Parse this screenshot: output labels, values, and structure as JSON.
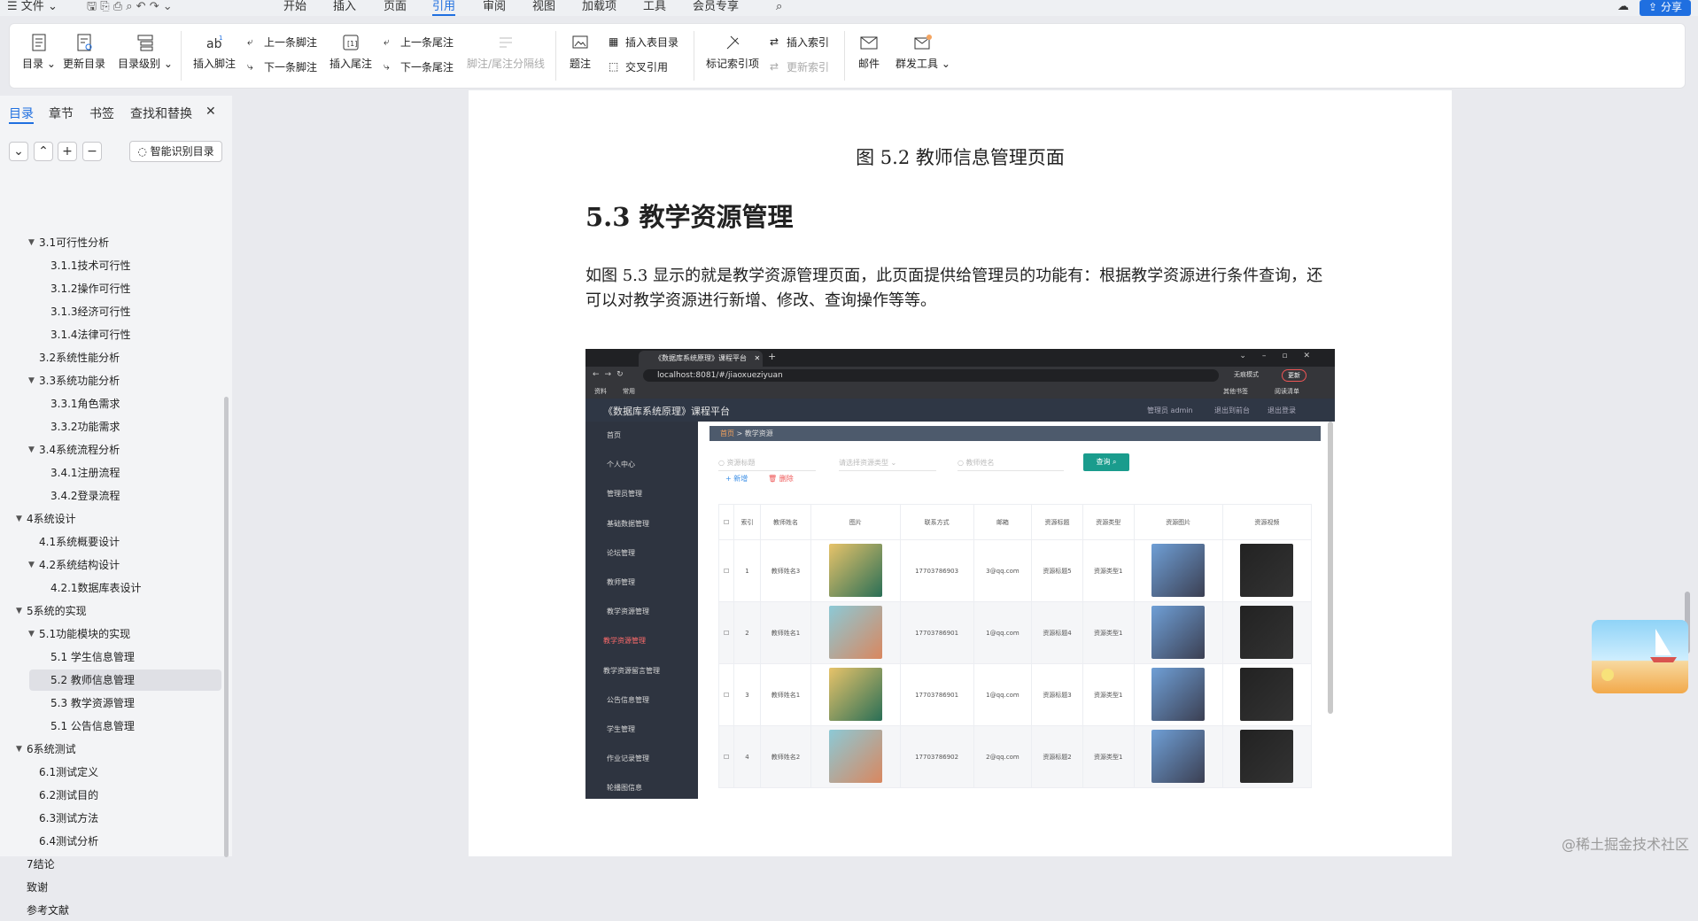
{
  "menubar": {
    "file": "文件",
    "tabs": [
      "开始",
      "插入",
      "页面",
      "引用",
      "审阅",
      "视图",
      "加载项",
      "工具",
      "会员专享"
    ],
    "active_tab": "引用",
    "share": "分享"
  },
  "ribbon": {
    "toc": "目录",
    "update_toc": "更新目录",
    "toc_level": "目录级别",
    "insert_footnote": "插入脚注",
    "prev_footnote": "上一条脚注",
    "next_footnote": "下一条脚注",
    "insert_endnote": "插入尾注",
    "prev_endnote": "上一条尾注",
    "next_endnote": "下一条尾注",
    "separator": "脚注/尾注分隔线",
    "caption": "题注",
    "insert_table_toc": "插入表目录",
    "cross_ref": "交叉引用",
    "mark_index": "标记索引项",
    "insert_index": "插入索引",
    "update_index": "更新索引",
    "mail": "邮件",
    "mass_tools": "群发工具"
  },
  "sidebar": {
    "tabs": [
      "目录",
      "章节",
      "书签",
      "查找和替换"
    ],
    "active_tab": "目录",
    "ai_button": "智能识别目录",
    "items": [
      {
        "text": "3.1可行性分析",
        "level": 2,
        "expanded": true
      },
      {
        "text": "3.1.1技术可行性",
        "level": 3
      },
      {
        "text": "3.1.2操作可行性",
        "level": 3
      },
      {
        "text": "3.1.3经济可行性",
        "level": 3
      },
      {
        "text": "3.1.4法律可行性",
        "level": 3
      },
      {
        "text": "3.2系统性能分析",
        "level": 2
      },
      {
        "text": "3.3系统功能分析",
        "level": 2,
        "expanded": true
      },
      {
        "text": "3.3.1角色需求",
        "level": 3
      },
      {
        "text": "3.3.2功能需求",
        "level": 3
      },
      {
        "text": "3.4系统流程分析",
        "level": 2,
        "expanded": true
      },
      {
        "text": "3.4.1注册流程",
        "level": 3
      },
      {
        "text": "3.4.2登录流程",
        "level": 3
      },
      {
        "text": "4系统设计",
        "level": 1,
        "expanded": true
      },
      {
        "text": "4.1系统概要设计",
        "level": 2
      },
      {
        "text": "4.2系统结构设计",
        "level": 2,
        "expanded": true
      },
      {
        "text": "4.2.1数据库表设计",
        "level": 3
      },
      {
        "text": "5系统的实现",
        "level": 1,
        "expanded": true
      },
      {
        "text": "5.1功能模块的实现",
        "level": 2,
        "expanded": true
      },
      {
        "text": "5.1 学生信息管理",
        "level": 3
      },
      {
        "text": "5.2  教师信息管理",
        "level": 3,
        "selected": true
      },
      {
        "text": "5.3 教学资源管理",
        "level": 3
      },
      {
        "text": "5.1 公告信息管理",
        "level": 3
      },
      {
        "text": "6系统测试",
        "level": 1,
        "expanded": true
      },
      {
        "text": "6.1测试定义",
        "level": 2
      },
      {
        "text": "6.2测试目的",
        "level": 2
      },
      {
        "text": "6.3测试方法",
        "level": 2
      },
      {
        "text": "6.4测试分析",
        "level": 2
      },
      {
        "text": "7结论",
        "level": 1
      },
      {
        "text": "致谢",
        "level": 1
      },
      {
        "text": "参考文献",
        "level": 1
      }
    ]
  },
  "document": {
    "caption": "图 5.2  教师信息管理页面",
    "heading": "5.3 教学资源管理",
    "paragraph": "如图 5.3 显示的就是教学资源管理页面，此页面提供给管理员的功能有：根据教学资源进行条件查询，还可以对教学资源进行新增、修改、查询操作等等。"
  },
  "screenshot": {
    "browser_tab": "《数据库系统原理》课程平台",
    "url": "localhost:8081/#/jiaoxueziyuan",
    "incognito": "无痕模式",
    "update": "更新",
    "bookmarks": [
      "资料",
      "常用"
    ],
    "bookmarks_right": [
      "其他书签",
      "阅读清单"
    ],
    "app_title": "《数据库系统原理》课程平台",
    "admin": "管理员 admin",
    "back_home": "退出到前台",
    "logout": "退出登录",
    "menu": [
      "首页",
      "个人中心",
      "管理员管理",
      "基础数据管理",
      "论坛管理",
      "教师管理",
      "教学资源管理",
      "教学资源管理",
      "教学资源留言管理",
      "公告信息管理",
      "学生管理",
      "作业记录管理",
      "轮播图信息"
    ],
    "crumb_home": "首页",
    "crumb_current": "教学资源",
    "search_title": "资源标题",
    "search_type": "请选择资源类型",
    "search_teacher": "教师姓名",
    "query": "查询",
    "add": "新增",
    "delete": "删除",
    "columns": [
      "索引",
      "教师姓名",
      "图片",
      "联系方式",
      "邮箱",
      "资源标题",
      "资源类型",
      "资源图片",
      "资源视频"
    ],
    "rows": [
      {
        "idx": "1",
        "teacher": "教师姓名3",
        "phone": "17703786903",
        "email": "3@qq.com",
        "title": "资源标题5",
        "type": "资源类型1"
      },
      {
        "idx": "2",
        "teacher": "教师姓名1",
        "phone": "17703786901",
        "email": "1@qq.com",
        "title": "资源标题4",
        "type": "资源类型1"
      },
      {
        "idx": "3",
        "teacher": "教师姓名1",
        "phone": "17703786901",
        "email": "1@qq.com",
        "title": "资源标题3",
        "type": "资源类型1"
      },
      {
        "idx": "4",
        "teacher": "教师姓名2",
        "phone": "17703786902",
        "email": "2@qq.com",
        "title": "资源标题2",
        "type": "资源类型1"
      }
    ]
  },
  "watermark": "@稀土掘金技术社区",
  "colors": {
    "accent": "#1f6fe0",
    "app_sidebar": "#2e3440",
    "query_button": "#1a9c8d"
  }
}
